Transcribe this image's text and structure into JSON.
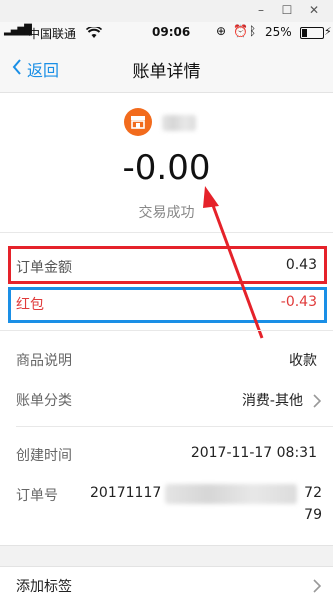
{
  "window": {
    "minimize": "–",
    "maximize": "☐",
    "close": "✕"
  },
  "status": {
    "signal": "▂▄▆█",
    "carrier": "中国联通",
    "wifi": "WiFi",
    "time": "09:06",
    "battery_pct": "25%"
  },
  "nav": {
    "back_label": "返回",
    "title": "账单详情"
  },
  "summary": {
    "amount": "-0.00",
    "status": "交易成功"
  },
  "order": {
    "amount_label": "订单金额",
    "amount_value": "0.43",
    "redpacket_label": "红包",
    "redpacket_value": "-0.43"
  },
  "details": {
    "desc_label": "商品说明",
    "desc_value": "收款",
    "category_label": "账单分类",
    "category_value": "消费-其他",
    "created_label": "创建时间",
    "created_value": "2017-11-17 08:31",
    "orderno_label": "订单号",
    "orderno_part1": "20171117",
    "orderno_part2": "72",
    "orderno_part3": "79"
  },
  "tag": {
    "label": "添加标签"
  },
  "colors": {
    "red_box": "#e5222a",
    "blue_box": "#1a8fe6",
    "red_text": "#e03b3b",
    "accent": "#1a8fe6",
    "store": "#f26b1d"
  }
}
